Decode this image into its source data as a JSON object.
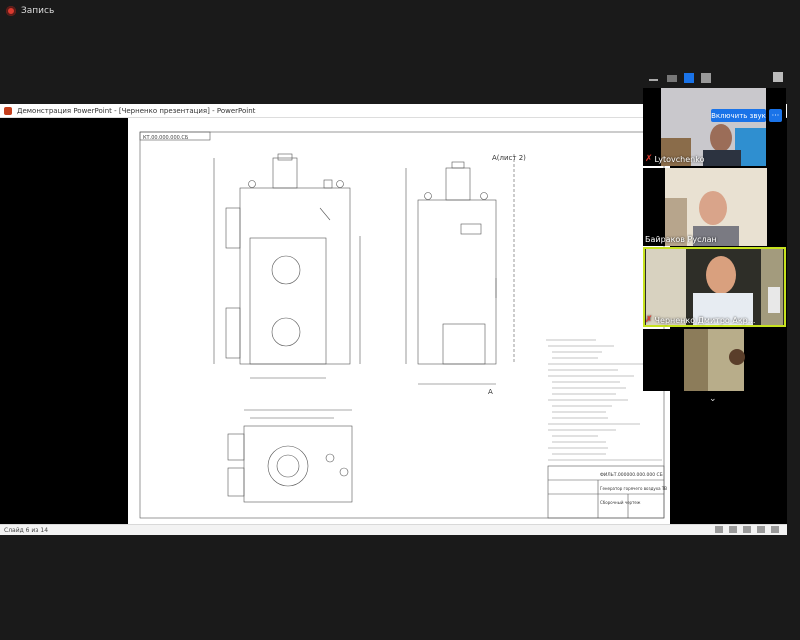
{
  "recording": {
    "label": "Запись"
  },
  "powerpoint": {
    "window_title": "Демонстрация PowerPoint - [Черненко презентация] - PowerPoint",
    "status_bar": {
      "slide_label": "Слайд 6 из 14"
    }
  },
  "drawing": {
    "doc_code": "КТ.00.000.000.СБ",
    "section_label": "А(лист 2)",
    "arrow_label": "А",
    "drawing_number": "ФИЛЬТ.000000.000.000 СБ",
    "product_name": "Генератор горячего воздуха ТВ",
    "sheet_note": "Сборочный чертеж"
  },
  "participants": {
    "unmute_button": "Включить звук",
    "more_button": "···",
    "tiles": [
      {
        "name": "Lytovchenko",
        "muted": true
      },
      {
        "name": "Байраков Руслан",
        "muted": false
      },
      {
        "name": "Черненко Дмитро Акр...",
        "muted": true
      },
      {
        "name": "",
        "muted": false
      }
    ]
  },
  "colors": {
    "accent": "#1a73e8",
    "active_border": "#c7e21f",
    "recording": "#d93a2f"
  }
}
